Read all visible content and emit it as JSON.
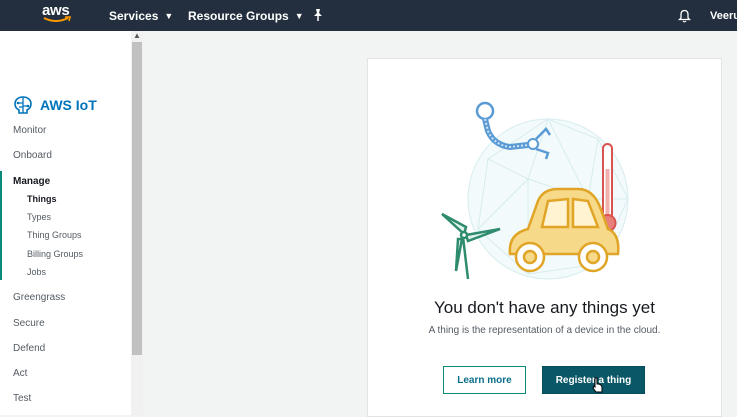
{
  "topnav": {
    "logo_text": "aws",
    "services_label": "Services",
    "resource_groups_label": "Resource Groups",
    "user_label": "Veerus",
    "icons": {
      "services_chevron": "chevron-down-icon",
      "resource_groups_chevron": "chevron-down-icon",
      "pin": "pin-icon",
      "notifications": "bell-icon"
    }
  },
  "sidebar": {
    "brand": "AWS IoT",
    "sections": [
      {
        "label": "Monitor"
      },
      {
        "label": "Onboard"
      },
      {
        "label": "Manage",
        "active": true
      },
      {
        "label": "Greengrass"
      },
      {
        "label": "Secure"
      },
      {
        "label": "Defend"
      },
      {
        "label": "Act"
      },
      {
        "label": "Test"
      }
    ],
    "manage_items": [
      {
        "label": "Things",
        "active": true
      },
      {
        "label": "Types"
      },
      {
        "label": "Thing Groups"
      },
      {
        "label": "Billing Groups"
      },
      {
        "label": "Jobs"
      }
    ]
  },
  "main": {
    "empty_title": "You don't have any things yet",
    "empty_subtitle": "A thing is the representation of a device in the cloud.",
    "learn_more_label": "Learn more",
    "register_label": "Register a thing"
  },
  "colors": {
    "topnav_bg": "#232f3e",
    "brand_blue": "#0073bb",
    "primary_button": "#0a5767",
    "active_accent": "#0a8a7a"
  }
}
